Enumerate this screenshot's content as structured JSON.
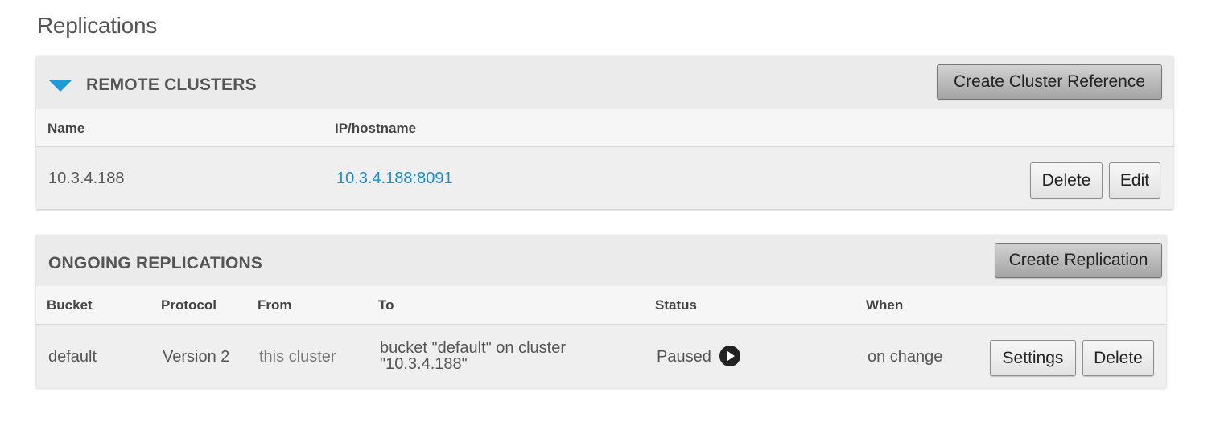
{
  "page": {
    "title": "Replications"
  },
  "remote_clusters": {
    "title": "REMOTE CLUSTERS",
    "create_button": "Create Cluster Reference",
    "columns": {
      "name": "Name",
      "ip": "IP/hostname"
    },
    "rows": [
      {
        "name": "10.3.4.188",
        "ip": "10.3.4.188:8091",
        "delete_label": "Delete",
        "edit_label": "Edit"
      }
    ]
  },
  "ongoing_replications": {
    "title": "ONGOING REPLICATIONS",
    "create_button": "Create Replication",
    "columns": {
      "bucket": "Bucket",
      "protocol": "Protocol",
      "from": "From",
      "to": "To",
      "status": "Status",
      "when": "When"
    },
    "rows": [
      {
        "bucket": "default",
        "protocol": "Version 2",
        "from": "this cluster",
        "to_line1": "bucket \"default\" on cluster",
        "to_line2": "\"10.3.4.188\"",
        "status": "Paused",
        "status_icon": "play-icon",
        "when": "on change",
        "settings_label": "Settings",
        "delete_label": "Delete"
      }
    ]
  },
  "colors": {
    "accent": "#1e9ad6",
    "link": "#1a8ccc"
  }
}
